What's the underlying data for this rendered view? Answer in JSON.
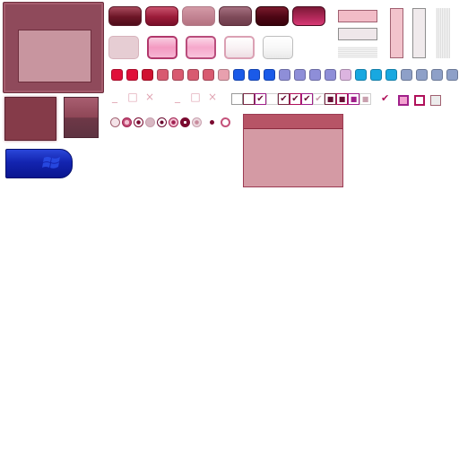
{
  "sprite": {
    "title": "",
    "colors": {
      "maroon": "#8f4a5b",
      "rose": "#c8959f",
      "pink": "#f39ac1",
      "blue": "#1324b0",
      "cyan": "#00a8e0"
    },
    "top_buttons": [
      "dark-maroon",
      "crimson",
      "dusty-rose",
      "mauve",
      "deep-maroon",
      "magenta"
    ],
    "rounded_buttons": [
      "light-rose",
      "pink-pressed",
      "pink-hover",
      "white-pink",
      "white-grey"
    ],
    "small_squares": [
      {
        "color": "#e0103a"
      },
      {
        "color": "#e0103a"
      },
      {
        "color": "#d0102f"
      },
      {
        "color": "#d85a70"
      },
      {
        "color": "#d85a70"
      },
      {
        "color": "#d85a70"
      },
      {
        "color": "#d85a70"
      },
      {
        "color": "#e8a0ae"
      },
      {
        "color": "#1a5ae8"
      },
      {
        "color": "#1a5ae8"
      },
      {
        "color": "#1a5ae8"
      },
      {
        "color": "#8e8ed8"
      },
      {
        "color": "#8e8ed8"
      },
      {
        "color": "#8e8ed8"
      },
      {
        "color": "#8e8ed8"
      },
      {
        "color": "#dcb4e0"
      },
      {
        "color": "#18a8e0"
      },
      {
        "color": "#18a8e0"
      },
      {
        "color": "#18a8e0"
      },
      {
        "color": "#8ea0c8"
      },
      {
        "color": "#8ea0c8"
      },
      {
        "color": "#8ea0c8"
      },
      {
        "color": "#8ea0c8"
      }
    ],
    "window_glyphs": [
      "_",
      "□",
      "×",
      "_",
      "□",
      "×"
    ],
    "checkbox_marks": [
      "",
      "",
      "✔",
      "",
      "✔",
      "✔",
      "✔",
      "✔",
      "■",
      "■",
      "■",
      "■"
    ],
    "extra_check": "✔"
  }
}
